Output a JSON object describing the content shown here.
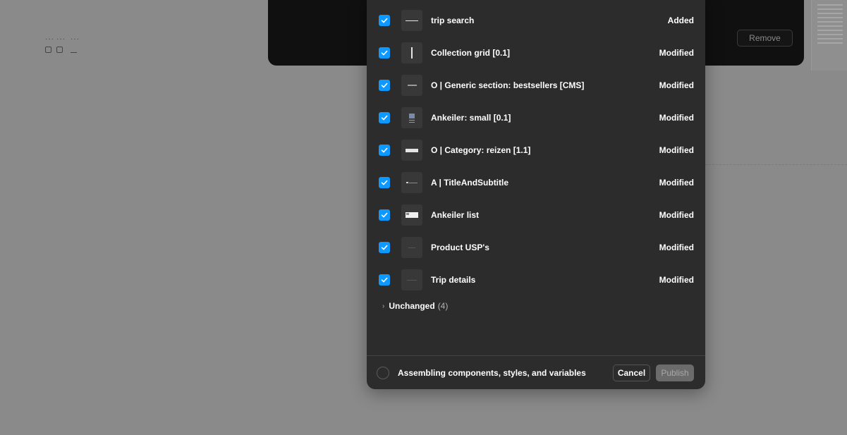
{
  "back_dialog": {
    "remove_label": "Remove"
  },
  "publish_modal": {
    "items": [
      {
        "name": "trip search",
        "status": "Added",
        "thumb": "line-icon",
        "checked": true
      },
      {
        "name": "Collection grid [0.1]",
        "status": "Modified",
        "thumb": "vertical-line-icon",
        "checked": true
      },
      {
        "name": "O | Generic section: bestsellers [CMS]",
        "status": "Modified",
        "thumb": "section-icon",
        "checked": true
      },
      {
        "name": "Ankeiler: small [0.1]",
        "status": "Modified",
        "thumb": "card-icon",
        "checked": true
      },
      {
        "name": "O | Category: reizen [1.1]",
        "status": "Modified",
        "thumb": "banner-icon",
        "checked": true
      },
      {
        "name": "A | TitleAndSubtitle",
        "status": "Modified",
        "thumb": "title-icon",
        "checked": true
      },
      {
        "name": "Ankeiler list",
        "status": "Modified",
        "thumb": "list-icon",
        "checked": true
      },
      {
        "name": "Product USP's",
        "status": "Modified",
        "thumb": "faint-line-icon",
        "checked": true
      },
      {
        "name": "Trip details",
        "status": "Modified",
        "thumb": "faint-line-icon",
        "checked": true
      }
    ],
    "unchanged": {
      "label": "Unchanged",
      "count": "(4)"
    },
    "footer": {
      "status_text": "Assembling components, styles, and variables",
      "cancel_label": "Cancel",
      "publish_label": "Publish"
    }
  },
  "colors": {
    "accent": "#0d99ff",
    "modal_bg": "#2c2c2c",
    "canvas_bg": "#8a8a8a"
  }
}
